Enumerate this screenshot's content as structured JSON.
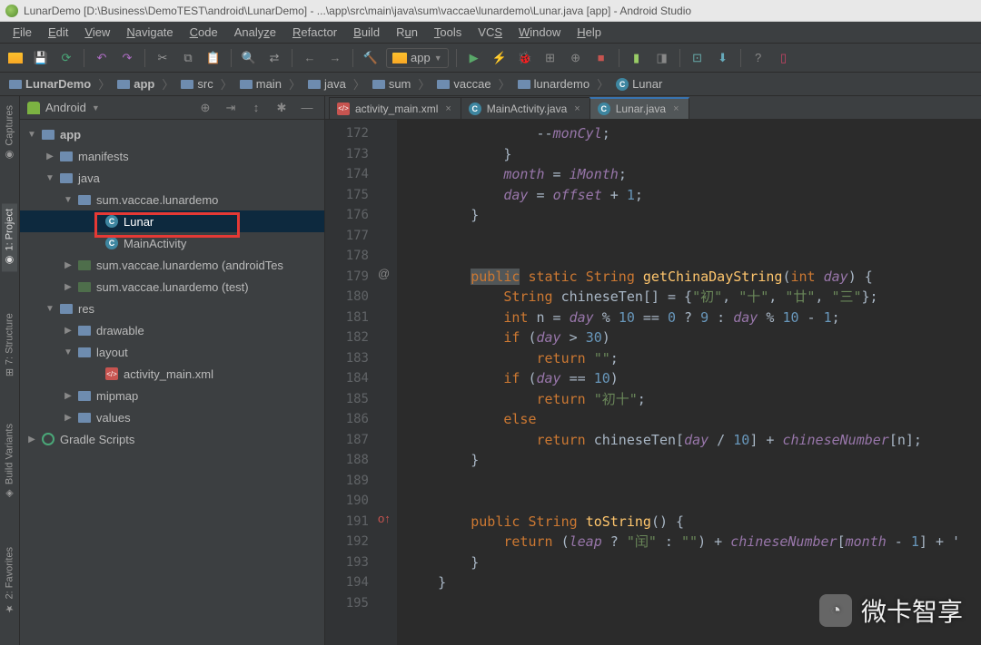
{
  "title": "LunarDemo [D:\\Business\\DemoTEST\\android\\LunarDemo] - ...\\app\\src\\main\\java\\sum\\vaccae\\lunardemo\\Lunar.java [app] - Android Studio",
  "menus": [
    "File",
    "Edit",
    "View",
    "Navigate",
    "Code",
    "Analyze",
    "Refactor",
    "Build",
    "Run",
    "Tools",
    "VCS",
    "Window",
    "Help"
  ],
  "run_config": "app",
  "breadcrumb": [
    "LunarDemo",
    "app",
    "src",
    "main",
    "java",
    "sum",
    "vaccae",
    "lunardemo",
    "Lunar"
  ],
  "panel": {
    "title": "Android"
  },
  "tree": {
    "app": "app",
    "manifests": "manifests",
    "java": "java",
    "pkg_main": "sum.vaccae.lunardemo",
    "lunar": "Lunar",
    "main_activity": "MainActivity",
    "pkg_atest": "sum.vaccae.lunardemo (androidTes",
    "pkg_test": "sum.vaccae.lunardemo (test)",
    "res": "res",
    "drawable": "drawable",
    "layout": "layout",
    "layout_file": "activity_main.xml",
    "mipmap": "mipmap",
    "values": "values",
    "gradle": "Gradle Scripts"
  },
  "tabs": [
    {
      "name": "activity_main.xml",
      "type": "xml"
    },
    {
      "name": "MainActivity.java",
      "type": "class"
    },
    {
      "name": "Lunar.java",
      "type": "class",
      "active": true
    }
  ],
  "sidetabs": {
    "captures": "Captures",
    "project": "1: Project",
    "structure": "7: Structure",
    "variants": "Build Variants",
    "favorites": "2: Favorites"
  },
  "gutter": {
    "start": 172,
    "end": 195,
    "override": 191,
    "anno": 179
  },
  "code_lines": [
    "                --monCyl;",
    "            }",
    "            month = iMonth;",
    "            day = offset + 1;",
    "        }",
    "",
    "",
    "        public static String getChinaDayString(int day) {",
    "            String chineseTen[] = {\"初\", \"十\", \"廿\", \"三\"};",
    "            int n = day % 10 == 0 ? 9 : day % 10 - 1;",
    "            if (day > 30)",
    "                return \"\";",
    "            if (day == 10)",
    "                return \"初十\";",
    "            else",
    "                return chineseTen[day / 10] + chineseNumber[n];",
    "        }",
    "",
    "",
    "        public String toString() {",
    "            return (leap ? \"闰\" : \"\") + chineseNumber[month - 1] + '",
    "        }",
    "    }",
    ""
  ],
  "watermark": "微卡智享"
}
